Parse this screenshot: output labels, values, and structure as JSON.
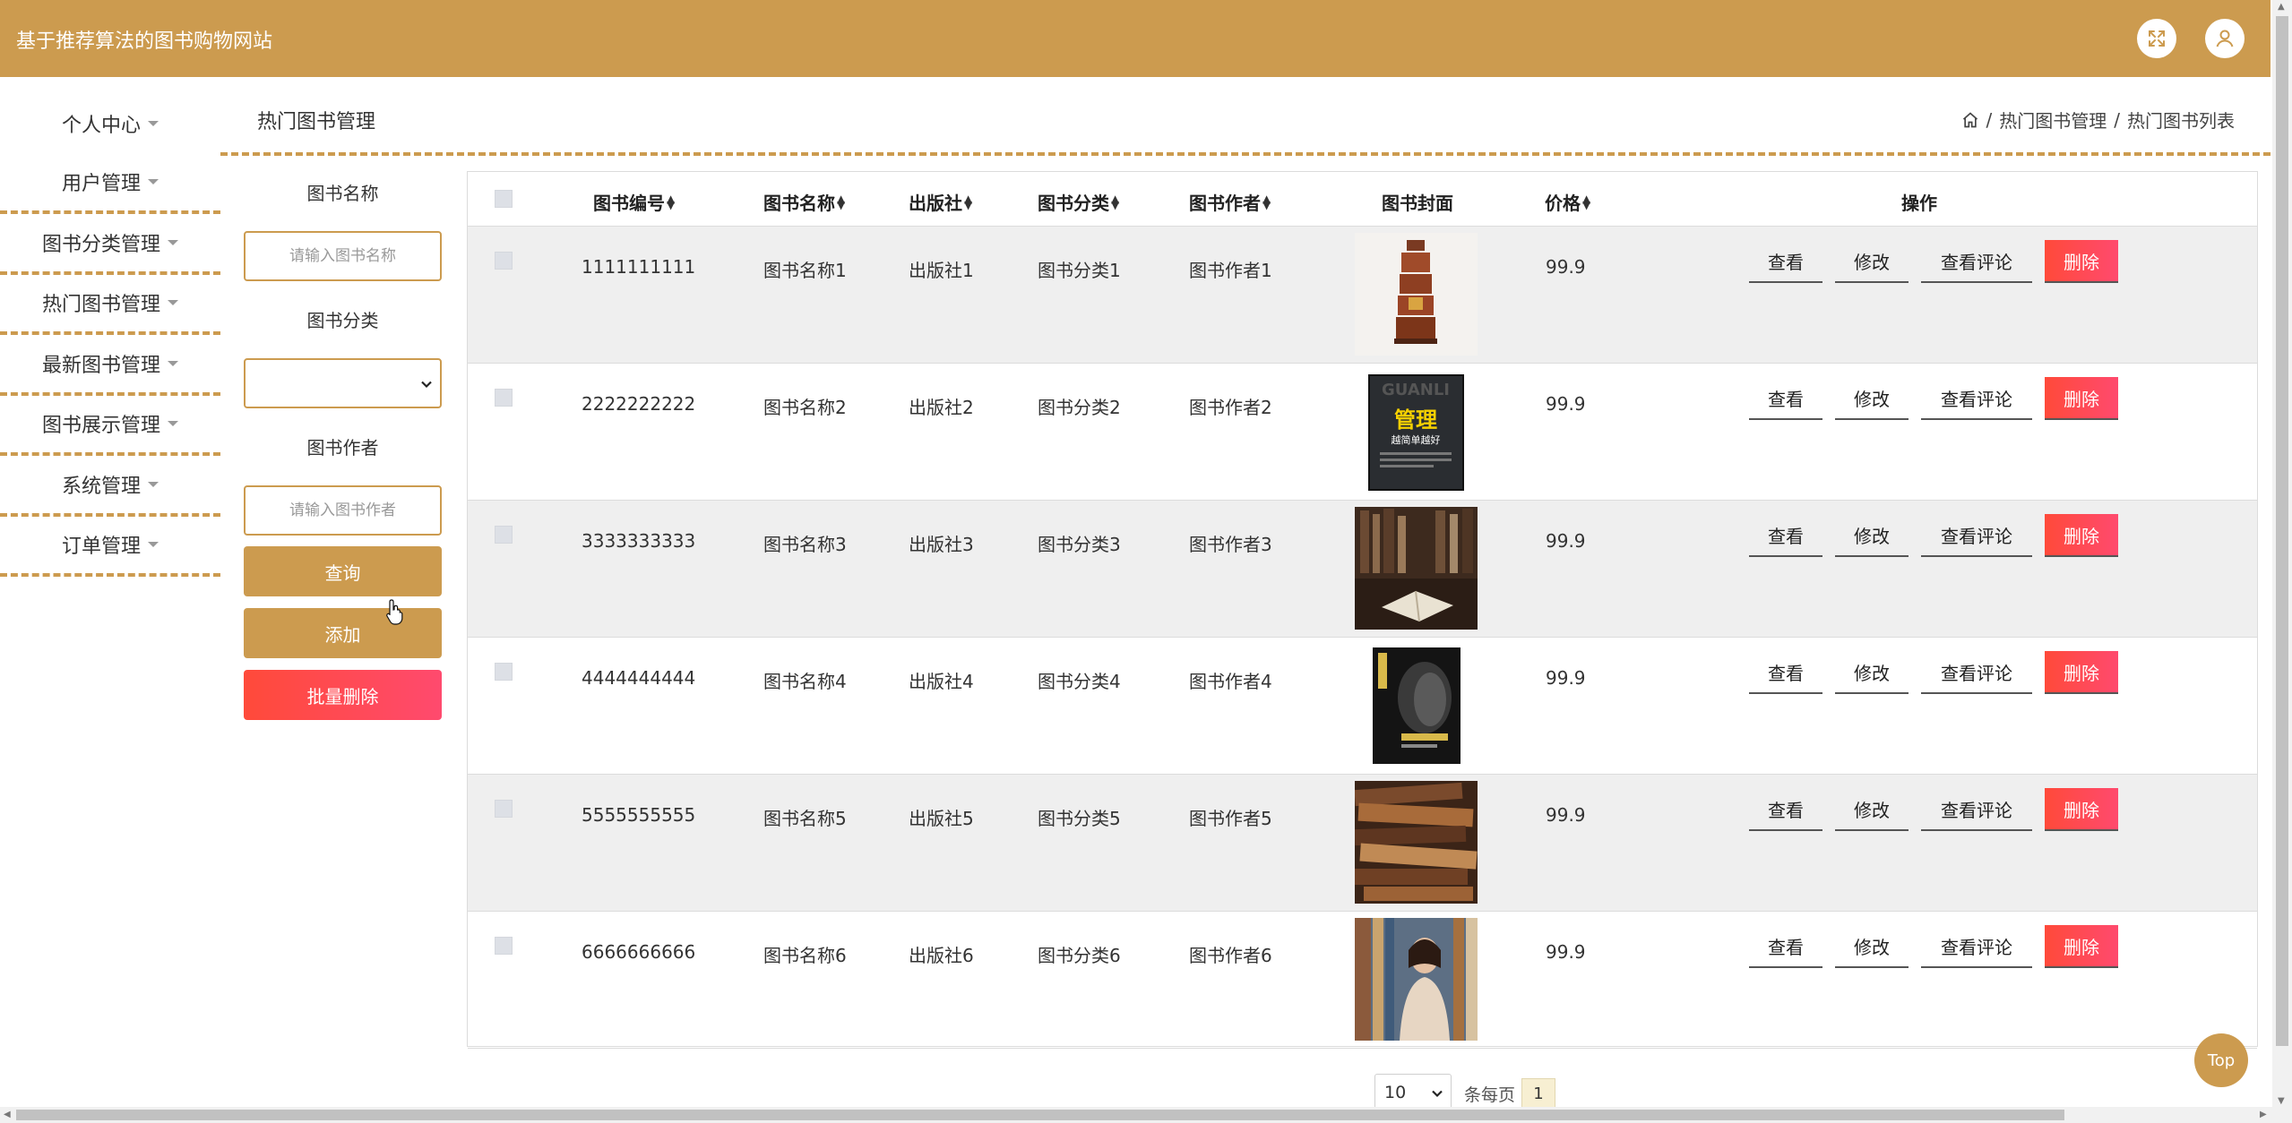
{
  "app": {
    "title": "基于推荐算法的图书购物网站"
  },
  "header": {
    "fullscreen_icon": "fullscreen-icon",
    "user_icon": "user-icon"
  },
  "sidebar": {
    "items": [
      {
        "label": "个人中心"
      },
      {
        "label": "用户管理"
      },
      {
        "label": "图书分类管理"
      },
      {
        "label": "热门图书管理"
      },
      {
        "label": "最新图书管理"
      },
      {
        "label": "图书展示管理"
      },
      {
        "label": "系统管理"
      },
      {
        "label": "订单管理"
      }
    ]
  },
  "page": {
    "title": "热门图书管理"
  },
  "breadcrumb": {
    "home_icon": "home-icon",
    "sep1": "/",
    "item1": "热门图书管理",
    "sep2": "/",
    "item2": "热门图书列表"
  },
  "search": {
    "name_label": "图书名称",
    "name_placeholder": "请输入图书名称",
    "category_label": "图书分类",
    "category_value": "",
    "author_label": "图书作者",
    "author_placeholder": "请输入图书作者",
    "query_button": "查询",
    "add_button": "添加",
    "batch_delete_button": "批量删除"
  },
  "table": {
    "columns": [
      "图书编号",
      "图书名称",
      "出版社",
      "图书分类",
      "图书作者",
      "图书封面",
      "价格",
      "操作"
    ],
    "rows": [
      {
        "id": "1111111111",
        "name": "图书名称1",
        "publisher": "出版社1",
        "category": "图书分类1",
        "author": "图书作者1",
        "price": "99.9"
      },
      {
        "id": "2222222222",
        "name": "图书名称2",
        "publisher": "出版社2",
        "category": "图书分类2",
        "author": "图书作者2",
        "price": "99.9"
      },
      {
        "id": "3333333333",
        "name": "图书名称3",
        "publisher": "出版社3",
        "category": "图书分类3",
        "author": "图书作者3",
        "price": "99.9"
      },
      {
        "id": "4444444444",
        "name": "图书名称4",
        "publisher": "出版社4",
        "category": "图书分类4",
        "author": "图书作者4",
        "price": "99.9"
      },
      {
        "id": "5555555555",
        "name": "图书名称5",
        "publisher": "出版社5",
        "category": "图书分类5",
        "author": "图书作者5",
        "price": "99.9"
      },
      {
        "id": "6666666666",
        "name": "图书名称6",
        "publisher": "出版社6",
        "category": "图书分类6",
        "author": "图书作者6",
        "price": "99.9"
      }
    ],
    "actions": {
      "view": "查看",
      "edit": "修改",
      "comments": "查看评论",
      "delete": "删除"
    },
    "cover_texts": {
      "cover2_title": "管理",
      "cover2_subtitle": "越简单越好"
    }
  },
  "pagination": {
    "page_size": "10",
    "per_page_label": "条每页",
    "current_page": "1"
  },
  "top_button": "Top",
  "colors": {
    "brand": "#cc9b4f",
    "danger": "#ff4a3a",
    "row_alt": "#efefef"
  }
}
